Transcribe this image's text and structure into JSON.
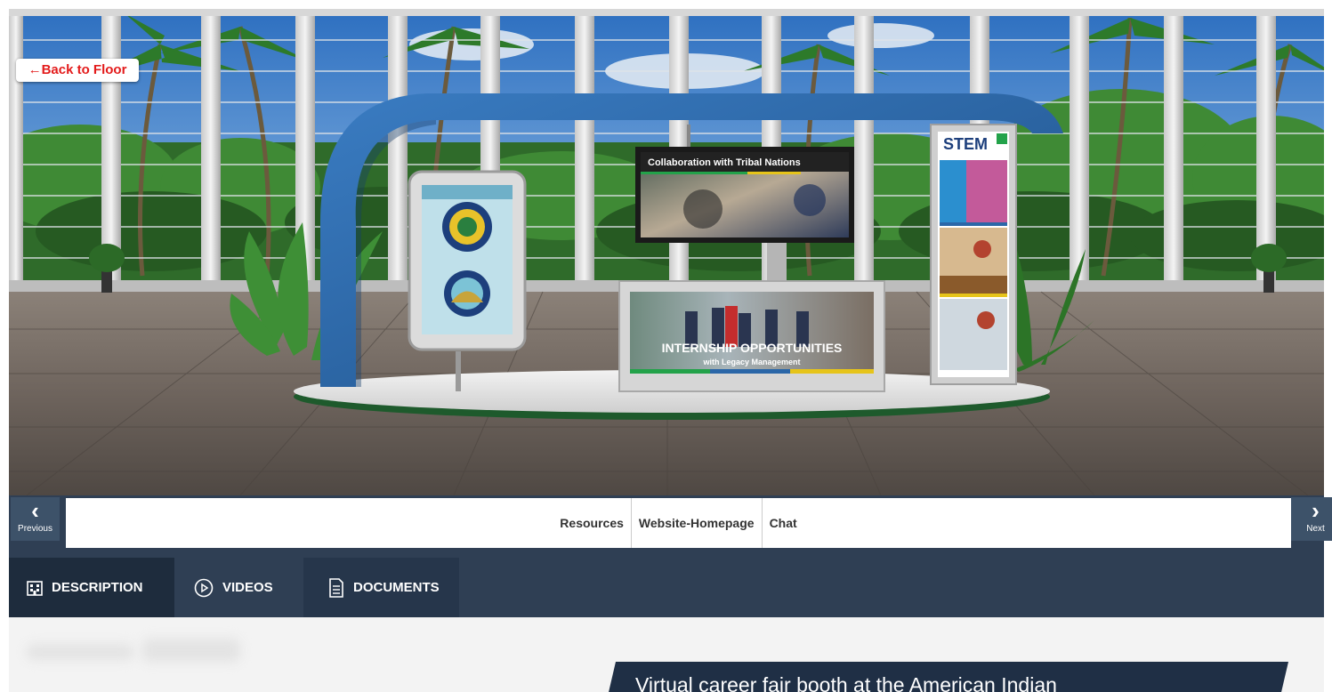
{
  "scene": {
    "back_button": "←Back to Floor",
    "screen_title": "Collaboration with Tribal Nations",
    "counter_title": "INTERNSHIP OPPORTUNITIES",
    "counter_subtitle": "with Legacy Management",
    "tower_label": "STEM"
  },
  "nav": {
    "previous_label": "Previous",
    "next_label": "Next",
    "links": [
      {
        "label": "Resources"
      },
      {
        "label": "Website-Homepage"
      },
      {
        "label": "Chat"
      }
    ]
  },
  "tabs": [
    {
      "label": "DESCRIPTION",
      "icon": "building-icon",
      "active": true
    },
    {
      "label": "VIDEOS",
      "icon": "play-circle-icon",
      "active": false
    },
    {
      "label": "DOCUMENTS",
      "icon": "document-icon",
      "active": false
    }
  ],
  "caption": {
    "text": "Virtual career fair booth at the American Indian"
  },
  "colors": {
    "frame": "#222222",
    "nav_bg": "#2f3f54",
    "tab_active_bg": "#1e2c3d",
    "booth_blue": "#2b67a8",
    "back_button_text": "#e31b1b",
    "caption_bg": "#1f2f45"
  }
}
